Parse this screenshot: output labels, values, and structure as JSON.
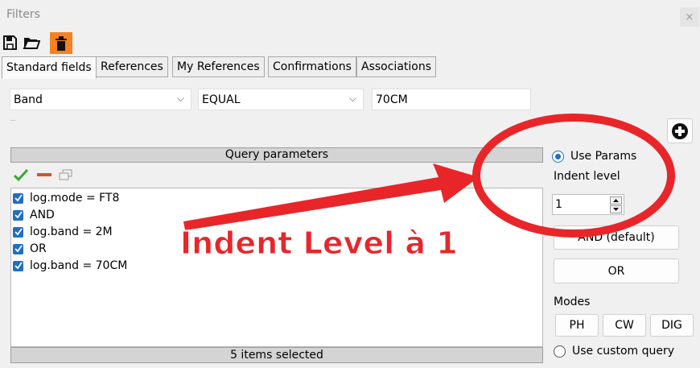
{
  "window": {
    "title": "Filters",
    "close": "×"
  },
  "tabs": [
    "Standard fields",
    "References",
    "My References",
    "Confirmations",
    "Associations"
  ],
  "filter": {
    "field": "Band",
    "operator": "EQUAL",
    "value": "70CM"
  },
  "query": {
    "header": "Query parameters",
    "items": [
      "log.mode = FT8",
      "AND",
      "log.band = 2M",
      "OR",
      "log.band = 70CM"
    ],
    "footer": "5 items selected"
  },
  "side": {
    "use_params": "Use Params",
    "indent_label": "Indent level",
    "indent_value": "1",
    "and_button": "AND (default)",
    "or_button": "OR",
    "modes_label": "Modes",
    "modes": [
      "PH",
      "CW",
      "DIG"
    ],
    "custom_query": "Use custom query"
  },
  "annotation": {
    "text": "Indent Level à 1",
    "color": "#e8262a"
  }
}
